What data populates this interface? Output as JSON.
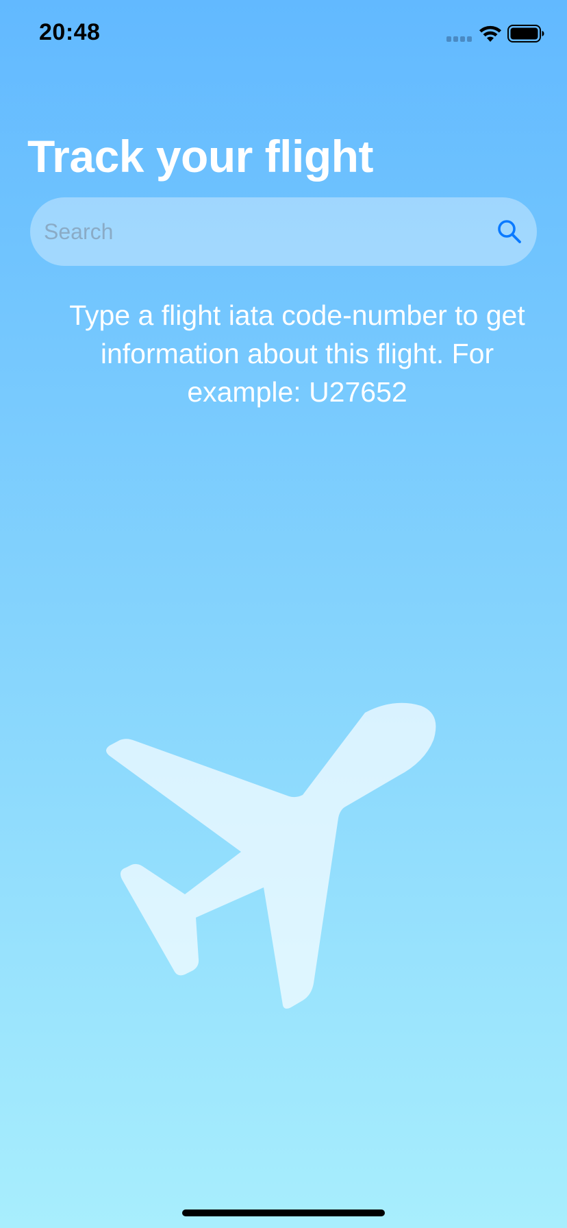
{
  "status_bar": {
    "time": "20:48",
    "icons": [
      "signal-icon",
      "wifi-icon",
      "battery-icon"
    ]
  },
  "header": {
    "title": "Track your flight"
  },
  "search": {
    "placeholder": "Search",
    "value": "",
    "icon": "search-icon"
  },
  "hint": {
    "text": "Type a flight iata code-number to get information about this flight. For example: U27652"
  },
  "illustration": {
    "icon": "airplane-icon"
  },
  "colors": {
    "background_top": "#62b9ff",
    "background_bottom": "#a8eefd",
    "accent": "#0a7aff",
    "text": "#ffffff"
  }
}
